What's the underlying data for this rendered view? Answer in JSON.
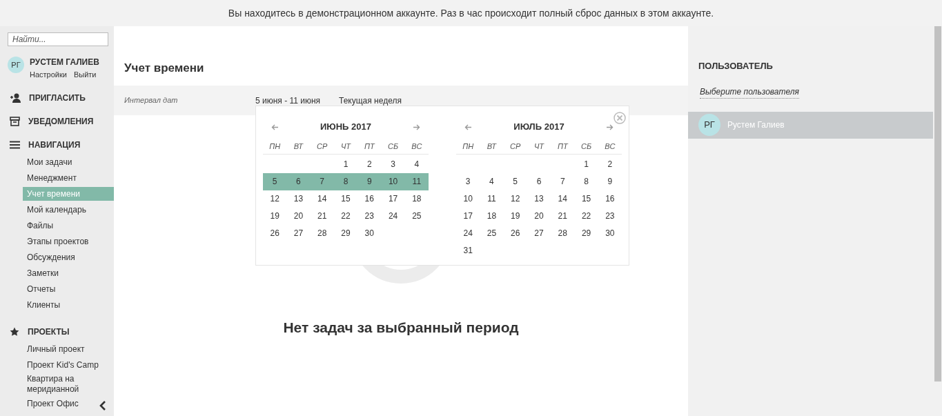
{
  "banner": "Вы находитесь в демонстрационном аккаунте. Раз в час происходит полный сброс данных в этом аккаунте.",
  "sidebar": {
    "search": {
      "placeholder": "Найти..."
    },
    "user": {
      "initials": "РГ",
      "name": "РУСТЕМ ГАЛИЕВ",
      "links": [
        "Настройки",
        "Выйти"
      ]
    },
    "sections": [
      {
        "kind": "invite",
        "title": "ПРИГЛАСИТЬ"
      },
      {
        "kind": "notifications",
        "title": "УВЕДОМЛЕНИЯ"
      },
      {
        "kind": "navigation",
        "title": "НАВИГАЦИЯ",
        "items": [
          {
            "label": "Мои задачи",
            "selected": false
          },
          {
            "label": "Менеджмент",
            "selected": false
          },
          {
            "label": "Учет времени",
            "selected": true
          },
          {
            "label": "Мой календарь",
            "selected": false
          },
          {
            "label": "Файлы",
            "selected": false
          },
          {
            "label": "Этапы проектов",
            "selected": false
          },
          {
            "label": "Обсуждения",
            "selected": false
          },
          {
            "label": "Заметки",
            "selected": false
          },
          {
            "label": "Отчеты",
            "selected": false
          },
          {
            "label": "Клиенты",
            "selected": false
          }
        ]
      },
      {
        "kind": "projects",
        "title": "ПРОЕКТЫ",
        "items": [
          {
            "label": "Личный проект",
            "selected": false
          },
          {
            "label": "Проект Kid's Camp",
            "selected": false
          },
          {
            "label": "Квартира на меридианной",
            "selected": false
          },
          {
            "label": "Проект Офис",
            "selected": false
          }
        ]
      }
    ]
  },
  "main": {
    "title": "Учет времени",
    "filter": {
      "label": "Интервал дат",
      "range": "5 июня - 11 июня",
      "preset": "Текущая неделя"
    },
    "empty_text": "Нет задач за выбранный период"
  },
  "calendar": {
    "months": [
      {
        "title": "ИЮНЬ 2017",
        "weekdays": [
          "ПН",
          "ВТ",
          "СР",
          "ЧТ",
          "ПТ",
          "СБ",
          "ВС"
        ],
        "weeks": [
          {
            "kind": "leading",
            "days": [
              {
                "day": "1",
                "selected": false
              },
              {
                "day": "2",
                "selected": false
              },
              {
                "day": "3",
                "selected": false
              },
              {
                "day": "4",
                "selected": false
              }
            ]
          },
          {
            "kind": "full",
            "days": [
              {
                "day": "5",
                "selected": true
              },
              {
                "day": "6",
                "selected": true
              },
              {
                "day": "7",
                "selected": true
              },
              {
                "day": "8",
                "selected": true
              },
              {
                "day": "9",
                "selected": true
              },
              {
                "day": "10",
                "selected": true
              },
              {
                "day": "11",
                "selected": true
              }
            ]
          },
          {
            "kind": "full",
            "days": [
              {
                "day": "12",
                "selected": false
              },
              {
                "day": "13",
                "selected": false
              },
              {
                "day": "14",
                "selected": false
              },
              {
                "day": "15",
                "selected": false
              },
              {
                "day": "16",
                "selected": false
              },
              {
                "day": "17",
                "selected": false
              },
              {
                "day": "18",
                "selected": false
              }
            ]
          },
          {
            "kind": "full",
            "days": [
              {
                "day": "19",
                "selected": false
              },
              {
                "day": "20",
                "selected": false
              },
              {
                "day": "21",
                "selected": false
              },
              {
                "day": "22",
                "selected": false
              },
              {
                "day": "23",
                "selected": false
              },
              {
                "day": "24",
                "selected": false
              },
              {
                "day": "25",
                "selected": false
              }
            ]
          },
          {
            "kind": "full",
            "days": [
              {
                "day": "26",
                "selected": false
              },
              {
                "day": "27",
                "selected": false
              },
              {
                "day": "28",
                "selected": false
              },
              {
                "day": "29",
                "selected": false
              },
              {
                "day": "30",
                "selected": false
              }
            ]
          }
        ]
      },
      {
        "title": "ИЮЛЬ 2017",
        "weekdays": [
          "ПН",
          "ВТ",
          "СР",
          "ЧТ",
          "ПТ",
          "СБ",
          "ВС"
        ],
        "weeks": [
          {
            "kind": "leading",
            "days": [
              {
                "day": "1",
                "selected": false
              },
              {
                "day": "2",
                "selected": false
              }
            ]
          },
          {
            "kind": "full",
            "days": [
              {
                "day": "3",
                "selected": false
              },
              {
                "day": "4",
                "selected": false
              },
              {
                "day": "5",
                "selected": false
              },
              {
                "day": "6",
                "selected": false
              },
              {
                "day": "7",
                "selected": false
              },
              {
                "day": "8",
                "selected": false
              },
              {
                "day": "9",
                "selected": false
              }
            ]
          },
          {
            "kind": "full",
            "days": [
              {
                "day": "10",
                "selected": false
              },
              {
                "day": "11",
                "selected": false
              },
              {
                "day": "12",
                "selected": false
              },
              {
                "day": "13",
                "selected": false
              },
              {
                "day": "14",
                "selected": false
              },
              {
                "day": "15",
                "selected": false
              },
              {
                "day": "16",
                "selected": false
              }
            ]
          },
          {
            "kind": "full",
            "days": [
              {
                "day": "17",
                "selected": false
              },
              {
                "day": "18",
                "selected": false
              },
              {
                "day": "19",
                "selected": false
              },
              {
                "day": "20",
                "selected": false
              },
              {
                "day": "21",
                "selected": false
              },
              {
                "day": "22",
                "selected": false
              },
              {
                "day": "23",
                "selected": false
              }
            ]
          },
          {
            "kind": "full",
            "days": [
              {
                "day": "24",
                "selected": false
              },
              {
                "day": "25",
                "selected": false
              },
              {
                "day": "26",
                "selected": false
              },
              {
                "day": "27",
                "selected": false
              },
              {
                "day": "28",
                "selected": false
              },
              {
                "day": "29",
                "selected": false
              },
              {
                "day": "30",
                "selected": false
              }
            ]
          },
          {
            "kind": "full",
            "days": [
              {
                "day": "31",
                "selected": false
              }
            ]
          }
        ]
      }
    ]
  },
  "user_panel": {
    "title": "ПОЛЬЗОВАТЕЛЬ",
    "select_label": "Выберите пользователя",
    "users": [
      {
        "initials": "РГ",
        "name": "Рустем Галиев",
        "selected": true
      }
    ]
  }
}
